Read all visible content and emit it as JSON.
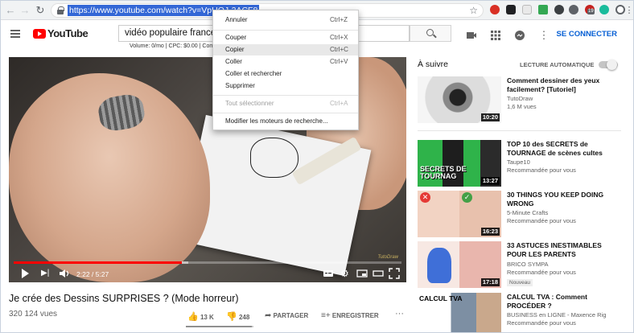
{
  "browser": {
    "url": "https://www.youtube.com/watch?v=VpUOJ-2ACF8",
    "ext_badges": [
      "19"
    ]
  },
  "header": {
    "logo": "YouTube",
    "search_value": "vidéo populaire france",
    "keyword_stats": "Volume: 0/mo | CPC: $0.00 | Com",
    "signin": "SE CONNECTER"
  },
  "context_menu": {
    "items": [
      {
        "label": "Annuler",
        "shortcut": "Ctrl+Z"
      },
      {
        "label": "Couper",
        "shortcut": "Ctrl+X"
      },
      {
        "label": "Copier",
        "shortcut": "Ctrl+C"
      },
      {
        "label": "Coller",
        "shortcut": "Ctrl+V"
      },
      {
        "label": "Coller et rechercher",
        "shortcut": ""
      },
      {
        "label": "Supprimer",
        "shortcut": ""
      },
      {
        "label": "Tout sélectionner",
        "shortcut": "Ctrl+A"
      },
      {
        "label": "Modifier les moteurs de recherche...",
        "shortcut": ""
      }
    ]
  },
  "player": {
    "time": "2:22 / 5:27",
    "watermark": "TutoDraw",
    "played_fraction": 0.434,
    "buffered_fraction": 0.45
  },
  "video": {
    "title": "Je crée des Dessins SURPRISES ? (Mode horreur)",
    "views": "320 124 vues",
    "likes": "13 K",
    "dislikes": "248",
    "share": "PARTAGER",
    "save": "ENREGISTRER",
    "like_ratio": 0.98
  },
  "sidebar": {
    "up_next": "À suivre",
    "autoplay": "LECTURE AUTOMATIQUE",
    "cards": [
      {
        "title": "Comment dessiner des yeux facilement? [Tutoriel]",
        "channel": "TutoDraw",
        "meta": "1,6 M vues",
        "duration": "10:20",
        "thumb_text": ""
      },
      {
        "title": "TOP 10 des SECRETS de TOURNAGE de scènes cultes",
        "channel": "Taupe10",
        "meta": "Recommandée pour vous",
        "duration": "13:27",
        "thumb_text": "SECRETS DE TOURNAG"
      },
      {
        "title": "30 THINGS YOU KEEP DOING WRONG",
        "channel": "5-Minute Crafts",
        "meta": "Recommandée pour vous",
        "duration": "16:23",
        "thumb_text": ""
      },
      {
        "title": "33 ASTUCES INESTIMABLES POUR LES PARENTS",
        "channel": "BRICO SYMPA",
        "meta": "Recommandée pour vous",
        "duration": "17:18",
        "badge": "Nouveau",
        "thumb_text": ""
      },
      {
        "title": "CALCUL TVA : Comment PROCÉDER ?",
        "channel": "BUSINESS en LIGNE - Maxence Rig",
        "meta": "Recommandée pour vous",
        "duration": "",
        "thumb_text": "CALCUL TVA"
      }
    ]
  }
}
